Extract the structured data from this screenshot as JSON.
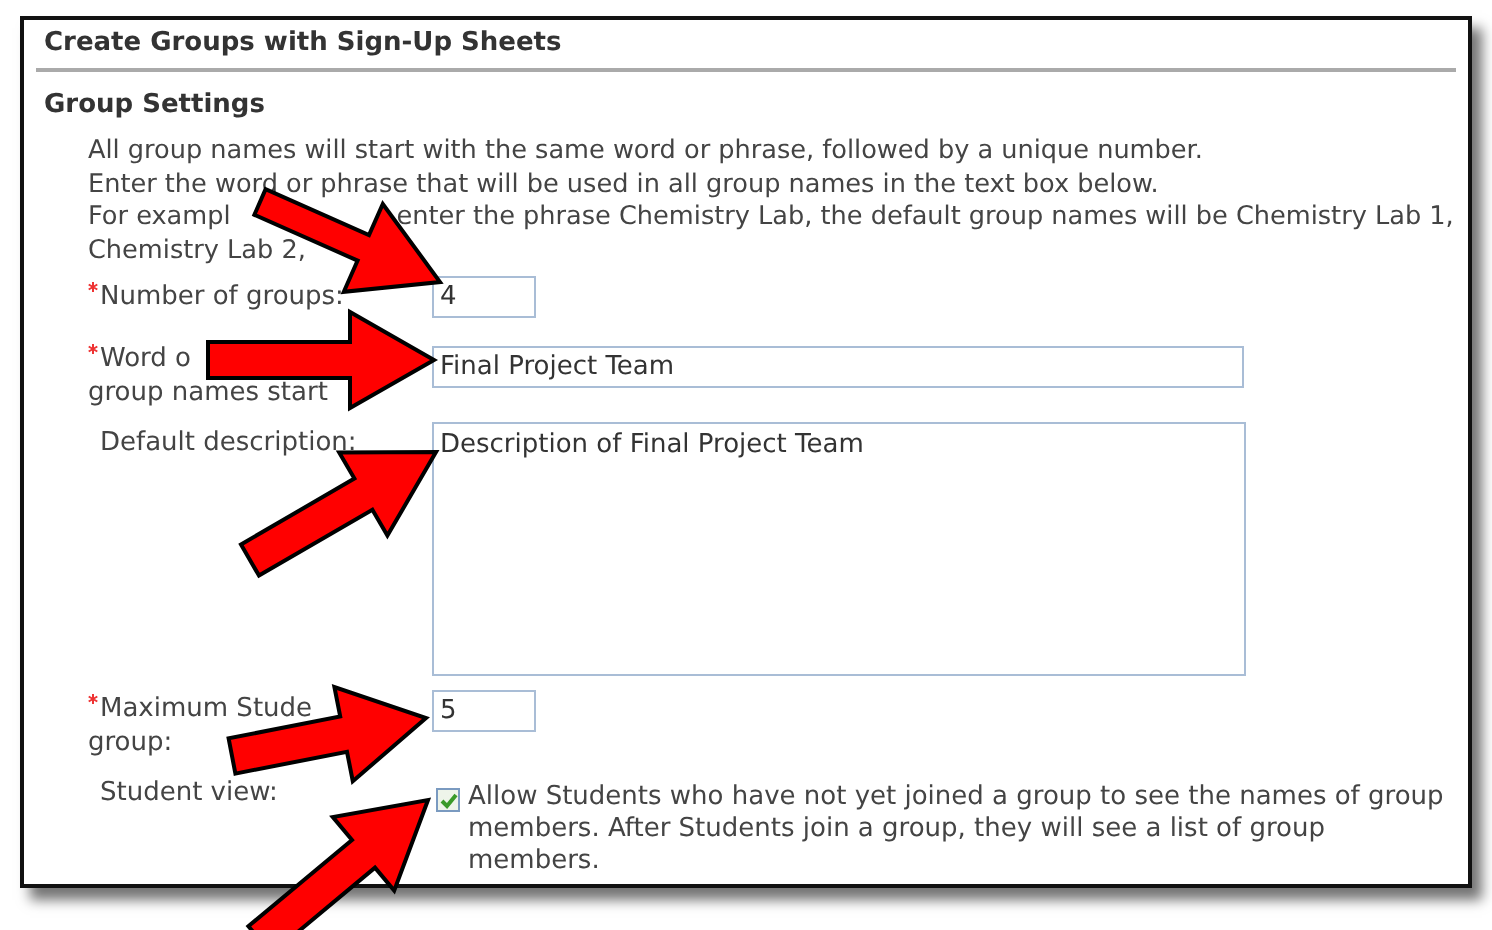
{
  "panel": {
    "title": "Create Groups with Sign-Up Sheets"
  },
  "section": {
    "title": "Group Settings",
    "intro": [
      [
        "All group names will start with the same word or phrase, followed by a unique number."
      ],
      [
        "Enter the word or phrase that will be used in all group names in the text box below."
      ],
      [
        "For exampl",
        "enter the phrase Chemistry Lab, the default group names will be Chemistry Lab 1,"
      ],
      [
        "Chemistry Lab 2,"
      ]
    ]
  },
  "fields": [
    {
      "kind": "input",
      "label": [
        [
          "Number of groups:"
        ]
      ],
      "required": true,
      "value": "4"
    },
    {
      "kind": "input",
      "label": [
        [
          "Word o"
        ],
        [
          "group names start"
        ]
      ],
      "required": true,
      "value": "Final Project Team"
    },
    {
      "kind": "textarea",
      "label": [
        [
          "Default description:"
        ]
      ],
      "required": false,
      "value": "Description of Final Project Team"
    },
    {
      "kind": "input",
      "label": [
        [
          "Maximum Stude"
        ],
        [
          "group:"
        ]
      ],
      "required": true,
      "value": "5"
    },
    {
      "kind": "checkbox",
      "label": [
        [
          "Student view:"
        ]
      ],
      "required": false,
      "checked": true,
      "text": "Allow Students who have not yet joined a group to see the names of group members. After Students join a group, they will see a list of group members."
    }
  ]
}
